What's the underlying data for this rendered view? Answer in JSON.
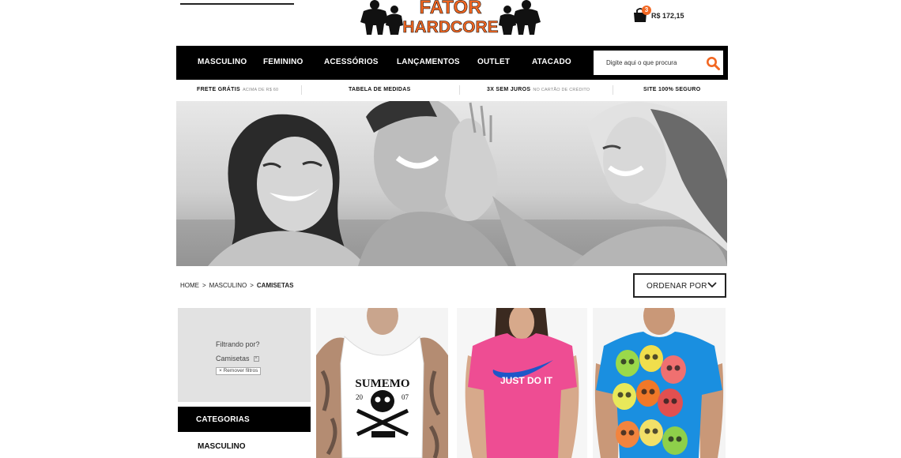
{
  "brand": {
    "logo_line1": "FATOR",
    "logo_line2": "HARDCORE"
  },
  "cart": {
    "count": "3",
    "total": "R$ 172,15"
  },
  "nav": {
    "items": [
      "MASCULINO",
      "FEMININO",
      "ACESSÓRIOS",
      "LANÇAMENTOS",
      "OUTLET",
      "ATACADO"
    ]
  },
  "search": {
    "placeholder": "Digite aqui o que procura"
  },
  "info_strip": {
    "items": [
      {
        "label": "FRETE GRÁTIS",
        "sub": "ACIMA DE R$ 60"
      },
      {
        "label": "TABELA DE MEDIDAS",
        "sub": ""
      },
      {
        "label": "3X SEM JUROS",
        "sub": "NO CARTÃO DE CRÉDITO"
      },
      {
        "label": "SITE 100% SEGURO",
        "sub": ""
      }
    ]
  },
  "breadcrumb": {
    "items": [
      "HOME",
      "MASCULINO",
      "CAMISETAS"
    ],
    "separator": ">"
  },
  "sort": {
    "label": "ORDENAR POR"
  },
  "filters": {
    "title": "Filtrando por?",
    "active": [
      "Camisetas"
    ],
    "remove_label": "Remover filtros"
  },
  "categories": {
    "heading": "CATEGORIAS",
    "items": [
      "MASCULINO"
    ]
  },
  "products": [
    {
      "print_line1": "SUMEMO",
      "print_year_left": "20",
      "print_year_right": "07",
      "color": "#ffffff"
    },
    {
      "print": "JUST DO IT",
      "color": "#ee4d93"
    },
    {
      "print": "",
      "color": "#1a8fe0"
    }
  ],
  "colors": {
    "accent": "#f26722",
    "nav_bg": "#000000",
    "panel_bg": "#e2e2e2"
  },
  "icons": {
    "cart": "shopping-bag-icon",
    "search": "search-icon",
    "sort": "chevron-down-icon",
    "remove": "close-icon"
  }
}
